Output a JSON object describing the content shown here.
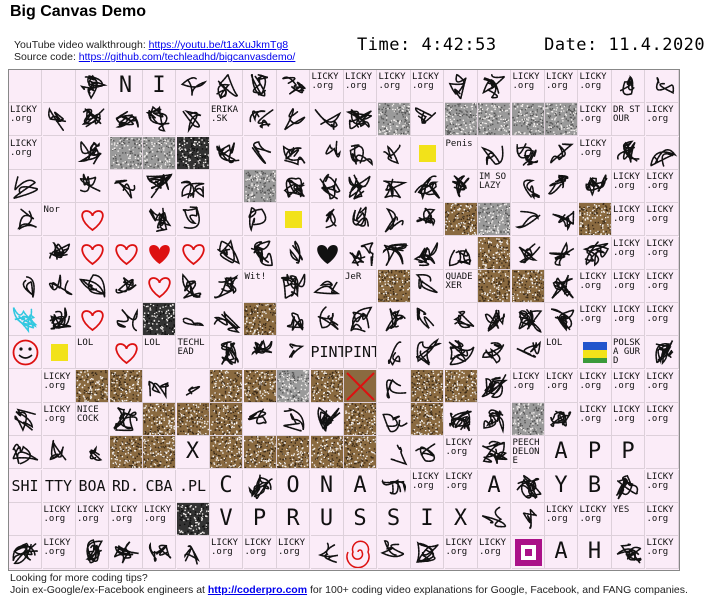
{
  "page_title": "Big Canvas Demo",
  "links": {
    "video_prefix": "YouTube video walkthrough:",
    "video_url": "https://youtu.be/t1aXuJkmTg8",
    "source_prefix": "Source code:",
    "source_url": "https://github.com/techleadhd/bigcanvasdemo/"
  },
  "clock": {
    "time_label": "Time:",
    "time_value": "4:42:53",
    "date_label": "Date:",
    "date_value": "11.4.2020"
  },
  "canvas": {
    "cols": 20,
    "rows": 15,
    "colors": {
      "background": "#fbecf8",
      "grid": "#ddd0da",
      "ink": "#111111",
      "noise_gray": "#9a9a9a",
      "noise_brown": "#8a6a40",
      "red": "#dd1111",
      "yellow": "#f2e21a",
      "blue": "#2255cc",
      "cyan": "#33c8e0",
      "purple": "#aa1188"
    },
    "tiles": [
      [
        "",
        "",
        "draw",
        "big:N",
        "big:I",
        "draw",
        "draw",
        "draw",
        "draw",
        "licky",
        "licky",
        "licky",
        "licky",
        "draw",
        "draw",
        "licky",
        "licky",
        "licky",
        "draw",
        "draw"
      ],
      [
        "licky",
        "draw",
        "draw",
        "draw",
        "draw",
        "draw",
        "text:ERIKA .SK",
        "draw",
        "draw",
        "draw",
        "draw",
        "noise-gray",
        "draw",
        "noise-gray",
        "noise-gray",
        "noise-gray",
        "noise-gray",
        "licky",
        "text:DR STOUR",
        "licky"
      ],
      [
        "licky",
        "",
        "draw",
        "noise-gray",
        "noise-gray",
        "noise-dark",
        "draw",
        "draw",
        "draw",
        "draw",
        "draw",
        "draw",
        "yellow",
        "text:Penis",
        "draw",
        "draw",
        "draw",
        "licky",
        "draw",
        "draw"
      ],
      [
        "draw",
        "",
        "draw",
        "draw",
        "draw",
        "draw",
        "",
        "noise-gray",
        "draw",
        "draw",
        "draw",
        "draw",
        "draw",
        "draw",
        "text:IM SO LAZY",
        "draw",
        "draw",
        "draw",
        "licky",
        "licky"
      ],
      [
        "draw",
        "text:Nor",
        "red-outline",
        "",
        "draw",
        "draw",
        "",
        "draw",
        "yellow",
        "draw",
        "draw",
        "draw",
        "draw",
        "noise-brown",
        "noise-gray",
        "draw",
        "draw",
        "noise-brown",
        "licky",
        "licky"
      ],
      [
        "",
        "draw",
        "red-outline",
        "red-outline",
        "red-fill",
        "red-outline",
        "draw",
        "draw",
        "draw",
        "black-heart",
        "draw",
        "draw",
        "draw",
        "draw",
        "noise-brown",
        "draw",
        "draw",
        "draw",
        "licky",
        "licky"
      ],
      [
        "draw",
        "draw",
        "draw",
        "draw",
        "red-outline",
        "draw",
        "draw",
        "text:Wit!",
        "draw",
        "draw",
        "text:JeR",
        "noise-brown",
        "draw",
        "text:QUADEXER",
        "noise-brown",
        "noise-brown",
        "draw",
        "licky",
        "licky",
        "licky"
      ],
      [
        "cyan",
        "draw",
        "red-outline",
        "draw",
        "noise-dark",
        "draw",
        "draw",
        "noise-brown",
        "draw",
        "draw",
        "draw",
        "draw",
        "draw",
        "draw",
        "draw",
        "draw",
        "draw",
        "licky",
        "licky",
        "licky"
      ],
      [
        "red-face",
        "yellow",
        "text:LOL",
        "red-outline",
        "text:LOL",
        "text:TECHLEAD",
        "draw",
        "draw",
        "draw",
        "big:PINT",
        "big:PINT",
        "draw",
        "draw",
        "draw",
        "draw",
        "draw",
        "text:LOL",
        "colorful",
        "text:POLSKA GURD",
        "draw"
      ],
      [
        "",
        "licky",
        "noise-brown",
        "noise-brown",
        "draw",
        "draw",
        "noise-brown",
        "noise-brown",
        "noise-gray",
        "noise-brown",
        "red-x",
        "draw",
        "noise-brown",
        "noise-brown",
        "draw",
        "licky",
        "licky",
        "licky",
        "licky",
        "licky"
      ],
      [
        "draw",
        "licky",
        "text:NICE COCK",
        "draw",
        "noise-brown",
        "noise-brown",
        "noise-brown",
        "draw",
        "draw",
        "draw",
        "noise-brown",
        "draw",
        "noise-brown",
        "draw",
        "draw",
        "noise-gray",
        "draw",
        "licky",
        "licky",
        "licky"
      ],
      [
        "draw",
        "draw",
        "draw",
        "noise-brown",
        "noise-brown",
        "big:X",
        "noise-brown",
        "noise-brown",
        "noise-brown",
        "noise-brown",
        "noise-brown",
        "draw",
        "draw",
        "licky",
        "draw",
        "text:PEECH DELONE",
        "big:A",
        "big:P",
        "big:P",
        ""
      ],
      [
        "big:SHI",
        "big:TTY",
        "big:BOA",
        "big:RD.",
        "big:CBA",
        "big:.PL",
        "big:C",
        "draw",
        "big:O",
        "big:N",
        "big:A",
        "draw",
        "licky",
        "licky",
        "big:A",
        "draw",
        "big:Y",
        "big:B",
        "draw",
        "licky"
      ],
      [
        "",
        "licky",
        "licky",
        "licky",
        "licky",
        "noise-dark",
        "big:V",
        "big:P",
        "big:R",
        "big:U",
        "big:S",
        "big:S",
        "big:I",
        "big:X",
        "draw",
        "draw",
        "licky",
        "licky",
        "text:YES",
        "licky"
      ],
      [
        "draw",
        "licky",
        "draw",
        "draw",
        "draw",
        "draw",
        "licky",
        "licky",
        "licky",
        "draw",
        "red-swirl",
        "draw",
        "draw",
        "licky",
        "licky",
        "purple",
        "big:A",
        "big:H",
        "draw",
        "licky"
      ]
    ]
  },
  "footer": {
    "line1": "Looking for more coding tips?",
    "line2_prefix": "Join ex-Google/ex-Facebook engineers at",
    "line2_link": "http://coderpro.com",
    "line2_suffix": "for 100+ coding video explanations for Google, Facebook, and FANG companies."
  }
}
